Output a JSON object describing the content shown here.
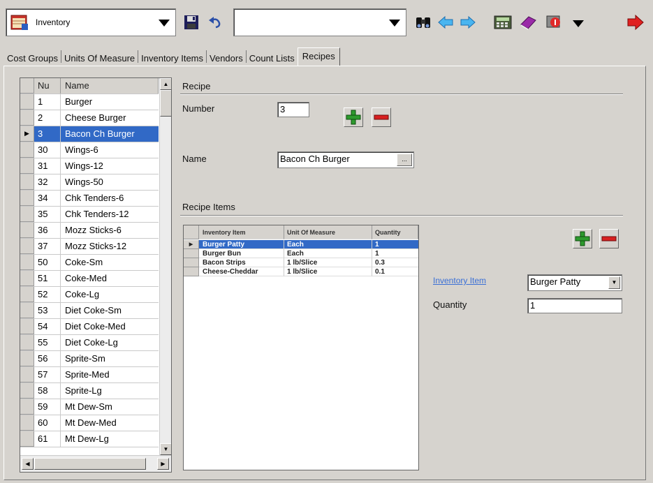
{
  "toolbar": {
    "module_value": "Inventory",
    "search_value": ""
  },
  "tabs": [
    "Cost Groups",
    "Units Of Measure",
    "Inventory Items",
    "Vendors",
    "Count Lists",
    "Recipes"
  ],
  "recipe_list": {
    "col_number": "Nu",
    "col_name": "Name",
    "rows": [
      {
        "num": "1",
        "name": "Burger"
      },
      {
        "num": "2",
        "name": "Cheese Burger"
      },
      {
        "num": "3",
        "name": "Bacon Ch Burger"
      },
      {
        "num": "30",
        "name": "Wings-6"
      },
      {
        "num": "31",
        "name": "Wings-12"
      },
      {
        "num": "32",
        "name": "Wings-50"
      },
      {
        "num": "34",
        "name": "Chk Tenders-6"
      },
      {
        "num": "35",
        "name": "Chk Tenders-12"
      },
      {
        "num": "36",
        "name": "Mozz Sticks-6"
      },
      {
        "num": "37",
        "name": "Mozz Sticks-12"
      },
      {
        "num": "50",
        "name": "Coke-Sm"
      },
      {
        "num": "51",
        "name": "Coke-Med"
      },
      {
        "num": "52",
        "name": "Coke-Lg"
      },
      {
        "num": "53",
        "name": "Diet Coke-Sm"
      },
      {
        "num": "54",
        "name": "Diet Coke-Med"
      },
      {
        "num": "55",
        "name": "Diet Coke-Lg"
      },
      {
        "num": "56",
        "name": "Sprite-Sm"
      },
      {
        "num": "57",
        "name": "Sprite-Med"
      },
      {
        "num": "58",
        "name": "Sprite-Lg"
      },
      {
        "num": "59",
        "name": "Mt Dew-Sm"
      },
      {
        "num": "60",
        "name": "Mt Dew-Med"
      },
      {
        "num": "61",
        "name": "Mt Dew-Lg"
      }
    ]
  },
  "recipe": {
    "section_title": "Recipe",
    "number_label": "Number",
    "number_value": "3",
    "name_label": "Name",
    "name_value": "Bacon Ch Burger",
    "ellipsis": "..."
  },
  "recipe_items": {
    "section_title": "Recipe Items",
    "columns": [
      "Inventory Item",
      "Unit Of Measure",
      "Quantity"
    ],
    "rows": [
      {
        "item": "Burger Patty",
        "uom": "Each",
        "qty": "1"
      },
      {
        "item": "Burger Bun",
        "uom": "Each",
        "qty": "1"
      },
      {
        "item": "Bacon Strips",
        "uom": "1 lb/Slice",
        "qty": "0.3"
      },
      {
        "item": "Cheese-Cheddar",
        "uom": "1 lb/Slice",
        "qty": "0.1"
      }
    ]
  },
  "item_editor": {
    "inventory_item_label": "Inventory Item",
    "inventory_item_value": "Burger Patty",
    "quantity_label": "Quantity",
    "quantity_value": "1"
  },
  "colors": {
    "selection": "#3169c6",
    "window_face": "#d6d3ce",
    "plus_green": "#2e9a2e",
    "minus_red": "#d82020"
  }
}
